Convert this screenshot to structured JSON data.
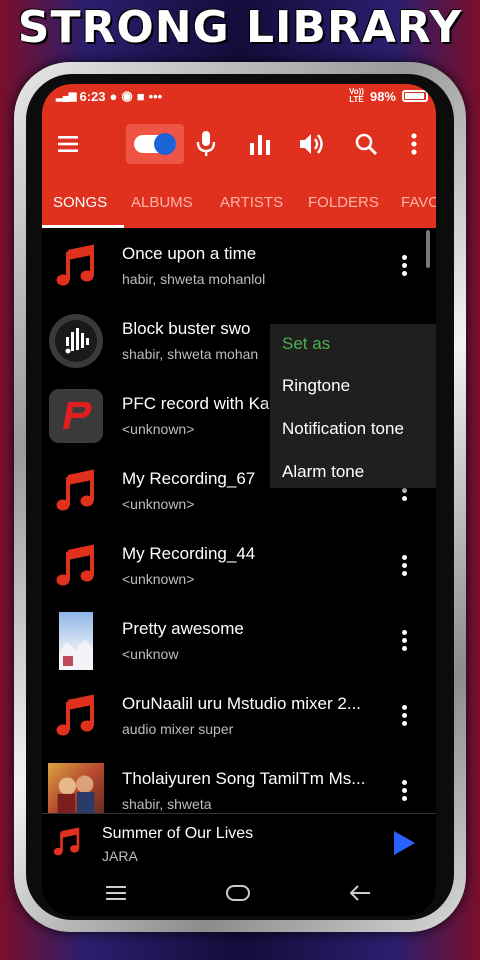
{
  "banner": "STRONG LIBRARY",
  "status": {
    "time": "6:23",
    "network": "LTE",
    "volte": "Vo))",
    "battery": "98%",
    "extra": "•••"
  },
  "appbar": {
    "icons": [
      "menu-icon",
      "toggle-icon",
      "mic-icon",
      "equalizer-icon",
      "volume-icon",
      "search-icon",
      "more-vert-icon"
    ]
  },
  "tabs": [
    "SONGS",
    "ALBUMS",
    "ARTISTS",
    "FOLDERS",
    "FAVO"
  ],
  "songs": [
    {
      "title": "Once upon a time",
      "subtitle": "habir, shweta mohanlol",
      "thumb": "music-note-icon"
    },
    {
      "title": "Block buster swo",
      "subtitle": "shabir, shweta mohan",
      "thumb": "audio-cut-icon"
    },
    {
      "title": "PFC record with Ka",
      "subtitle": "<unknown>",
      "thumb": "app-logo-icon"
    },
    {
      "title": "My Recording_67",
      "subtitle": "<unknown>",
      "thumb": "music-note-icon"
    },
    {
      "title": "My Recording_44",
      "subtitle": "<unknown>",
      "thumb": "music-note-icon"
    },
    {
      "title": "Pretty awesome",
      "subtitle": "<unknow",
      "thumb": "album-art"
    },
    {
      "title": "OruNaalil uru Mstudio mixer 2...",
      "subtitle": "audio mixer super",
      "thumb": "music-note-icon"
    },
    {
      "title": "Tholaiyuren Song TamilTm Ms...",
      "subtitle": "shabir, shweta",
      "thumb": "album-art"
    }
  ],
  "popup": {
    "header": "Set as",
    "options": [
      "Ringtone",
      "Notification tone",
      "Alarm tone"
    ]
  },
  "player": {
    "title": "Summer of Our Lives",
    "artist": "JARA"
  },
  "colors": {
    "accent": "#e0301e",
    "popup_header": "#4caf50",
    "play": "#2962ff"
  }
}
